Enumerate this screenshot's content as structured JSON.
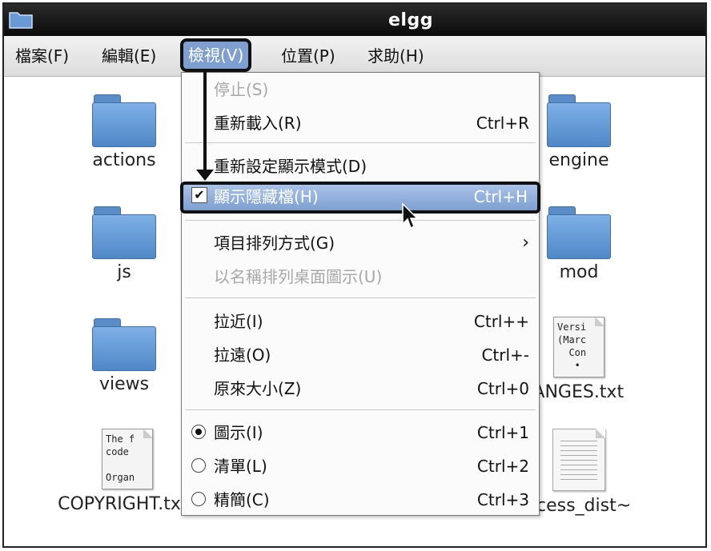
{
  "window": {
    "title": "elgg"
  },
  "menubar": {
    "items": [
      {
        "label": "檔案(F)"
      },
      {
        "label": "編輯(E)"
      },
      {
        "label": "檢視(V)"
      },
      {
        "label": "位置(P)"
      },
      {
        "label": "求助(H)"
      }
    ]
  },
  "files": {
    "actions": "actions",
    "engine": "engine",
    "js": "js",
    "mod": "mod",
    "views": "views",
    "changes": "IANGES.txt",
    "copyright": "COPYRIGHT.tx",
    "htaccess": "ccess_dist~",
    "changes_preview": "Versi\n(Marc\n  Con\n   •",
    "copyright_preview": "The f\ncode\n\nOrgan"
  },
  "view_menu": {
    "stop": "停止(S)",
    "reload": "重新載入(R)",
    "reload_acc": "Ctrl+R",
    "reset_view": "重新設定顯示模式(D)",
    "show_hidden": "顯示隱藏檔(H)",
    "show_hidden_acc": "Ctrl+H",
    "arrange_items": "項目排列方式(G)",
    "arrange_desktop": "以名稱排列桌面圖示(U)",
    "zoom_in": "拉近(I)",
    "zoom_in_acc": "Ctrl++",
    "zoom_out": "拉遠(O)",
    "zoom_out_acc": "Ctrl+-",
    "normal_size": "原來大小(Z)",
    "normal_size_acc": "Ctrl+0",
    "icons": "圖示(I)",
    "icons_acc": "Ctrl+1",
    "list": "清單(L)",
    "list_acc": "Ctrl+2",
    "compact": "精簡(C)",
    "compact_acc": "Ctrl+3",
    "check_glyph": "✔",
    "submenu_glyph": "›"
  },
  "colors": {
    "highlight": "#7e9fd2",
    "folder": "#5a8cc8",
    "titlebar": "#111111"
  }
}
